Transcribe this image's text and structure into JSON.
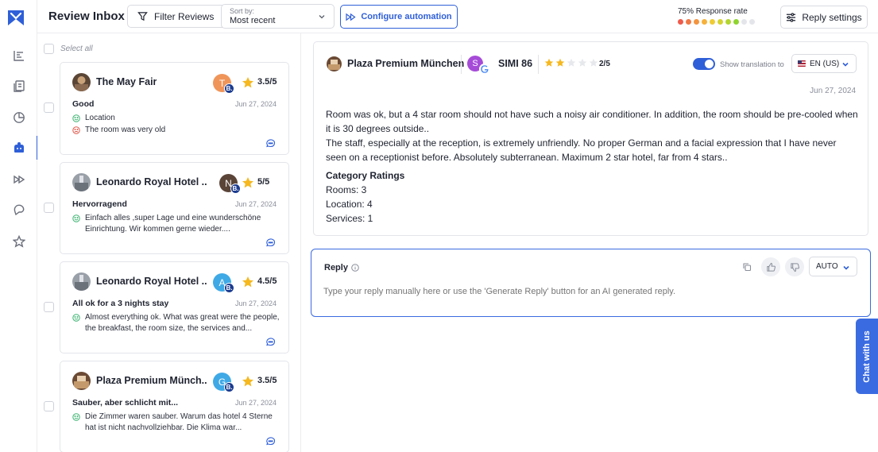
{
  "header": {
    "title": "Review Inbox",
    "filter_label": "Filter Reviews",
    "sort_label": "Sort by:",
    "sort_value": "Most recent",
    "automation_label": "Configure automation",
    "response_rate_text": "75% Response rate",
    "response_rate": 0.75,
    "reply_settings_label": "Reply settings"
  },
  "nav": [
    "analytics-icon",
    "reports-icon",
    "pie-chart-icon",
    "inbox-icon",
    "automation-icon",
    "chat-icon",
    "star-icon"
  ],
  "list": {
    "select_all": "Select all",
    "reviews": [
      {
        "hotel": "The May Fair",
        "user_initial": "T",
        "user_color": "#f0955a",
        "rating": "3.5/5",
        "title": "Good",
        "date": "Jun 27, 2024",
        "lines": [
          {
            "sentiment": "positive",
            "text": "Location"
          },
          {
            "sentiment": "negative",
            "text": "The room was very old"
          }
        ]
      },
      {
        "hotel": "Leonardo Royal Hotel ...",
        "user_initial": "N",
        "user_color": "#5a4438",
        "rating": "5/5",
        "title": "Hervorragend",
        "date": "Jun 27, 2024",
        "lines": [
          {
            "sentiment": "positive",
            "text": "Einfach alles ,super Lage und eine wunderschöne Einrichtung. Wir kommen gerne wieder...."
          }
        ]
      },
      {
        "hotel": "Leonardo Royal Hotel ...",
        "user_initial": "A",
        "user_color": "#3fa9e6",
        "rating": "4.5/5",
        "title": "All ok for a 3 nights stay",
        "date": "Jun 27, 2024",
        "lines": [
          {
            "sentiment": "positive",
            "text": "Almost everything ok. What was great were the people, the breakfast, the room size, the services and..."
          }
        ]
      },
      {
        "hotel": "Plaza Premium Münch...",
        "user_initial": "G",
        "user_color": "#3fa9e6",
        "rating": "3.5/5",
        "title": "Sauber, aber schlicht mit...",
        "date": "Jun 27, 2024",
        "lines": [
          {
            "sentiment": "positive",
            "text": "Die Zimmer waren sauber. Warum das hotel 4 Sterne hat ist nicht nachvollziehbar. Die Klima war..."
          }
        ]
      }
    ]
  },
  "detail": {
    "hotel": "Plaza Premium München",
    "user_initial": "S",
    "user_name": "SIMI 86",
    "rating_text": "2/5",
    "stars_filled": 2,
    "stars_total": 5,
    "translation_label": "Show translation to",
    "language": "EN (US)",
    "date": "Jun 27, 2024",
    "body": [
      "Room was ok, but a 4 star room should not have such a noisy air conditioner. In addition, the room should be pre-cooled when it is 30 degrees outside..",
      "The staff, especially at the reception, is extremely unfriendly. No proper German and a facial expression that I have never seen on a receptionist before. Absolutely subterranean. Maximum 2 star hotel, far from 4 stars.."
    ],
    "category_title": "Category Ratings",
    "categories": [
      "Rooms: 3",
      "Location: 4",
      "Services: 1"
    ]
  },
  "reply": {
    "label": "Reply",
    "mode": "AUTO",
    "placeholder": "Type your reply manually here or use the 'Generate Reply' button for an AI generated reply."
  },
  "chat_widget": "Chat with us"
}
